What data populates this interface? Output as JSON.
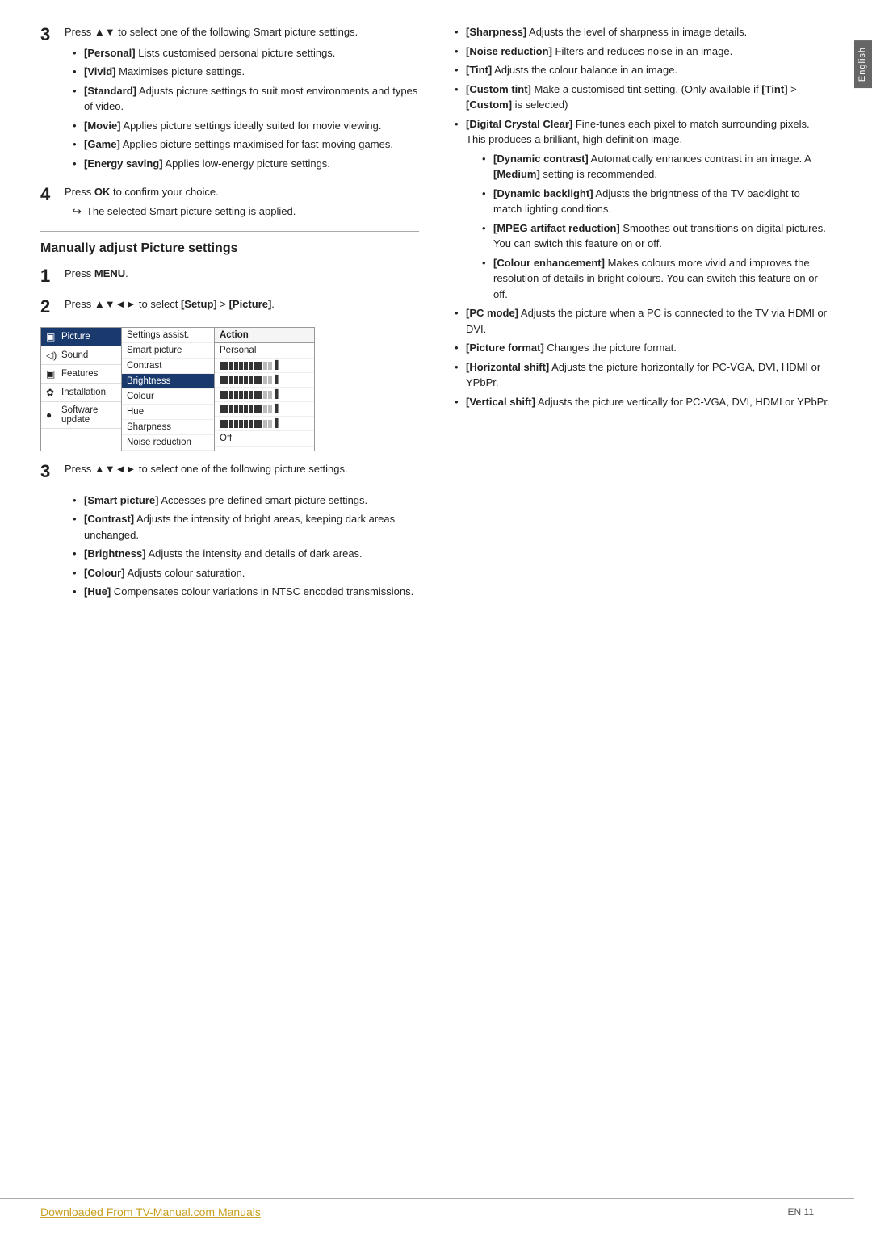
{
  "side_tab": {
    "label": "English"
  },
  "left_col": {
    "step3_intro": "Press ▲▼ to select one of the following Smart picture settings.",
    "step3_items": [
      "[Personal] Lists customised personal picture settings.",
      "[Vivid] Maximises picture settings.",
      "[Standard] Adjusts picture settings to suit most environments and types of video.",
      "[Movie] Applies picture settings ideally suited for movie viewing.",
      "[Game] Applies picture settings maximised for fast-moving games.",
      "[Energy saving] Applies low-energy picture settings."
    ],
    "step4_intro": "Press OK to confirm your choice.",
    "step4_arrow": "The selected Smart picture setting is applied.",
    "section_heading": "Manually adjust Picture settings",
    "step1_text": "Press MENU.",
    "step2_text": "Press ▲▼◄► to select [Setup] > [Picture].",
    "menu": {
      "left_items": [
        {
          "icon": "📷",
          "label": "Picture",
          "selected": true
        },
        {
          "icon": "🔊",
          "label": "Sound",
          "selected": false
        },
        {
          "icon": "⚙",
          "label": "Features",
          "selected": false
        },
        {
          "icon": "🔧",
          "label": "Installation",
          "selected": false
        },
        {
          "icon": "💿",
          "label": "Software update",
          "selected": false
        }
      ],
      "center_items": [
        {
          "label": "Settings assist.",
          "selected": false
        },
        {
          "label": "Smart picture",
          "selected": false
        },
        {
          "label": "Contrast",
          "selected": false
        },
        {
          "label": "Brightness",
          "selected": true
        },
        {
          "label": "Colour",
          "selected": false
        },
        {
          "label": "Hue",
          "selected": false
        },
        {
          "label": "Sharpness",
          "selected": false
        },
        {
          "label": "Noise reduction",
          "selected": false
        }
      ],
      "right_header": "Action",
      "right_items": [
        {
          "label": "Personal",
          "type": "text"
        },
        {
          "label": "bar",
          "type": "bar",
          "filled": 9,
          "empty": 2
        },
        {
          "label": "bar",
          "type": "bar",
          "filled": 9,
          "empty": 2
        },
        {
          "label": "bar",
          "type": "bar",
          "filled": 9,
          "empty": 2
        },
        {
          "label": "bar",
          "type": "bar",
          "filled": 9,
          "empty": 2
        },
        {
          "label": "bar",
          "type": "bar",
          "filled": 9,
          "empty": 2
        },
        {
          "label": "Off",
          "type": "text"
        }
      ]
    },
    "step3b_intro": "Press ▲▼◄► to select one of the following picture settings.",
    "step3b_items": [
      {
        "bold": "[Smart picture]",
        "rest": " Accesses pre-defined smart picture settings."
      },
      {
        "bold": "[Contrast]",
        "rest": " Adjusts the intensity of bright areas, keeping dark areas unchanged."
      },
      {
        "bold": "[Brightness]",
        "rest": " Adjusts the intensity and details of dark areas."
      },
      {
        "bold": "[Colour]",
        "rest": " Adjusts colour saturation."
      },
      {
        "bold": "[Hue]",
        "rest": " Compensates colour variations in NTSC encoded transmissions."
      }
    ]
  },
  "right_col": {
    "items": [
      {
        "bold": "[Sharpness]",
        "rest": " Adjusts the level of sharpness in image details."
      },
      {
        "bold": "[Noise reduction]",
        "rest": " Filters and reduces noise in an image."
      },
      {
        "bold": "[Tint]",
        "rest": " Adjusts the colour balance in an image."
      },
      {
        "bold": "[Custom tint]",
        "rest": " Make a customised tint setting. (Only available if [Tint] > [Custom] is selected)"
      },
      {
        "bold": "[Digital Crystal Clear]",
        "rest": " Fine-tunes each pixel to match surrounding pixels. This produces a brilliant, high-definition image.",
        "sub": [
          {
            "bold": "[Dynamic contrast]",
            "rest": " Automatically enhances contrast in an image. A [Medium] setting is recommended."
          },
          {
            "bold": "[Dynamic backlight]",
            "rest": " Adjusts the brightness of the TV backlight to match lighting conditions."
          },
          {
            "bold": "[MPEG artifact reduction]",
            "rest": " Smoothes out transitions on digital pictures. You can switch this feature on or off."
          },
          {
            "bold": "[Colour enhancement]",
            "rest": " Makes colours more vivid and improves the resolution of details in bright colours. You can switch this feature on or off."
          }
        ]
      },
      {
        "bold": "[PC mode]",
        "rest": " Adjusts the picture when a PC is connected to the TV via HDMI or DVI."
      },
      {
        "bold": "[Picture format]",
        "rest": " Changes the picture format."
      },
      {
        "bold": "[Horizontal shift]",
        "rest": " Adjusts the picture horizontally for PC-VGA, DVI, HDMI or YPbPr."
      },
      {
        "bold": "[Vertical shift]",
        "rest": " Adjusts the picture vertically for PC-VGA, DVI, HDMI or YPbPr."
      }
    ]
  },
  "footer": {
    "link": "Downloaded From TV-Manual.com Manuals",
    "page": "EN   11"
  }
}
